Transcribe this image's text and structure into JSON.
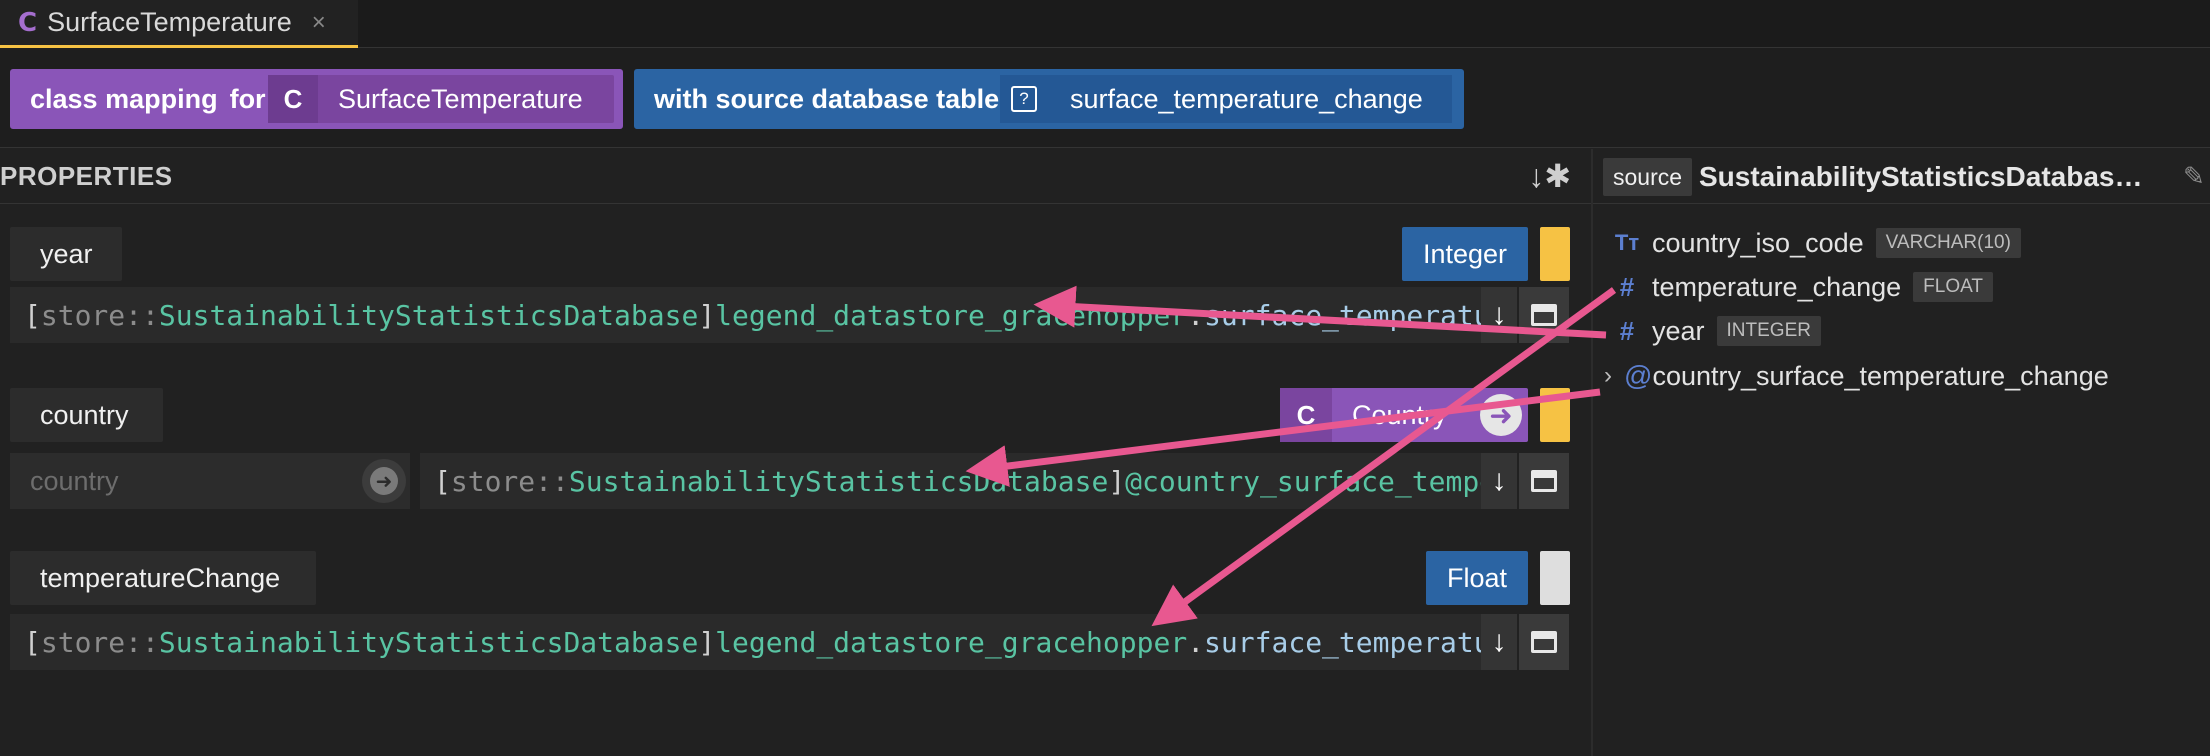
{
  "tab": {
    "icon": "class-icon",
    "icon_glyph": "C",
    "title": "SurfaceTemperature",
    "close_glyph": "×"
  },
  "header": {
    "class_mapping_label": "class mapping",
    "for_label": "for",
    "class_icon_glyph": "C",
    "class_name": "SurfaceTemperature",
    "source_label": "with source database table",
    "table_icon_glyph": "?",
    "table_name": "surface_temperature_change"
  },
  "properties": {
    "title": "PROPERTIES",
    "sort_glyph": "↓✱",
    "items": [
      {
        "name": "year",
        "type": "Integer",
        "multiplicity_color": "#f6c244",
        "expr": {
          "open": "[",
          "store": "store::",
          "db": "SustainabilityStatisticsDatabase",
          "close": "]",
          "schema": "legend_datastore_gracehopper",
          "dot": ".",
          "col": "surface_temperatu"
        }
      },
      {
        "name": "country",
        "type": "Country",
        "type_glyph": "C",
        "multiplicity_color": "#f6c244",
        "input_placeholder": "country",
        "expr": {
          "open": "[",
          "store": "store::",
          "db": "SustainabilityStatisticsDatabase",
          "close": "]",
          "join": "@country_surface_tempe"
        }
      },
      {
        "name": "temperatureChange",
        "type": "Float",
        "multiplicity_color": "#dedede",
        "expr": {
          "open": "[",
          "store": "store::",
          "db": "SustainabilityStatisticsDatabase",
          "close": "]",
          "schema": "legend_datastore_gracehopper",
          "dot": ".",
          "col": "surface_temperatu"
        }
      }
    ]
  },
  "source": {
    "tag": "source",
    "db_name": "SustainabilityStatisticsDatabase.le...",
    "edit_glyph": "✎",
    "columns": [
      {
        "icon": "text-type-icon",
        "glyph": "Tт",
        "name": "country_iso_code",
        "type": "VARCHAR(10)"
      },
      {
        "icon": "number-type-icon",
        "glyph": "#",
        "name": "temperature_change",
        "type": "FLOAT"
      },
      {
        "icon": "number-type-icon",
        "glyph": "#",
        "name": "year",
        "type": "INTEGER"
      }
    ],
    "join": {
      "chevron": "›",
      "at": "@",
      "name": "country_surface_temperature_change"
    }
  },
  "colors": {
    "class_purple": "#8a55b8",
    "type_blue": "#2b64a3",
    "tab_accent": "#f6c244",
    "arrow_pink": "#e85890",
    "db_green": "#59c4a3"
  }
}
